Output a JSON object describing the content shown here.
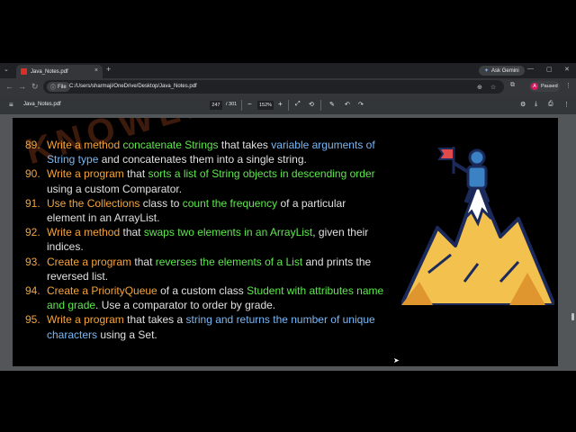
{
  "tab": {
    "title": "Java_Notes.pdf",
    "close": "×",
    "new_tab": "+",
    "menu": "⌄"
  },
  "gemini": "Ask Gemini",
  "window_controls": [
    "—",
    "▢",
    "✕"
  ],
  "nav": {
    "back": "←",
    "forward": "→",
    "reload": "↻"
  },
  "address": {
    "chip": "File",
    "url": "C:/Users/sharmaji/OneDrive/Desktop/Java_Notes.pdf"
  },
  "profile": {
    "initial": "A",
    "label": "Paused"
  },
  "pdf_toolbar": {
    "menu": "≡",
    "title": "Java_Notes.pdf",
    "page_current": "247",
    "page_total": "/ 301",
    "zoom_out": "−",
    "zoom": "152%",
    "zoom_in": "+",
    "undo": "↶",
    "redo": "↷",
    "download": "⤓",
    "print": "⎙",
    "more": "⋮"
  },
  "watermark": "KNOWLEDGEGATE",
  "items": [
    {
      "num": "89.",
      "parts": [
        {
          "t": "Write a method ",
          "c": "o"
        },
        {
          "t": "concatenate Strings",
          "c": "g"
        },
        {
          "t": " that takes ",
          "c": "w"
        },
        {
          "t": "variable arguments of String type",
          "c": "b"
        },
        {
          "t": " and concatenates them into a single string.",
          "c": "w"
        }
      ]
    },
    {
      "num": "90.",
      "parts": [
        {
          "t": "Write a program",
          "c": "o"
        },
        {
          "t": " that ",
          "c": "w"
        },
        {
          "t": "sorts a list of String objects in descending order",
          "c": "g"
        },
        {
          "t": " using a custom Comparator.",
          "c": "w"
        }
      ]
    },
    {
      "num": "91.",
      "parts": [
        {
          "t": "Use the Collections",
          "c": "o"
        },
        {
          "t": " class to ",
          "c": "w"
        },
        {
          "t": "count the frequency",
          "c": "g"
        },
        {
          "t": " of a particular element in an ArrayList.",
          "c": "w"
        }
      ]
    },
    {
      "num": "92.",
      "parts": [
        {
          "t": "Write a method",
          "c": "o"
        },
        {
          "t": " that ",
          "c": "w"
        },
        {
          "t": "swaps two elements in an ArrayList",
          "c": "g"
        },
        {
          "t": ", given their indices.",
          "c": "w"
        }
      ]
    },
    {
      "num": "93.",
      "parts": [
        {
          "t": "Create a program",
          "c": "o"
        },
        {
          "t": " that ",
          "c": "w"
        },
        {
          "t": "reverses the elements of a List",
          "c": "g"
        },
        {
          "t": " and prints the reversed list.",
          "c": "w"
        }
      ]
    },
    {
      "num": "94.",
      "parts": [
        {
          "t": "Create a PriorityQueue",
          "c": "o"
        },
        {
          "t": " of a custom class ",
          "c": "w"
        },
        {
          "t": "Student with attributes name and grade",
          "c": "g"
        },
        {
          "t": ". Use a comparator to order by grade.",
          "c": "w"
        }
      ]
    },
    {
      "num": "95.",
      "parts": [
        {
          "t": "Write a program",
          "c": "o"
        },
        {
          "t": " that takes a ",
          "c": "w"
        },
        {
          "t": "string and returns the number of unique characters",
          "c": "b"
        },
        {
          "t": " using a Set.",
          "c": "w"
        }
      ]
    }
  ]
}
